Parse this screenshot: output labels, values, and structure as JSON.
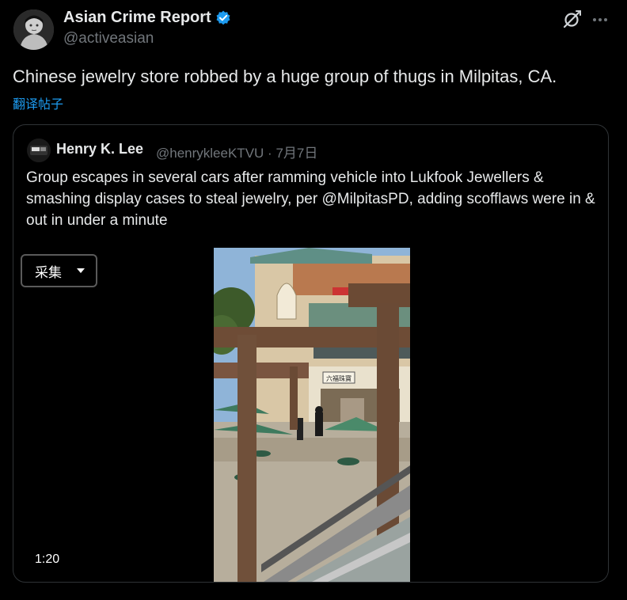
{
  "post": {
    "author_name": "Asian Crime Report",
    "author_handle": "@activeasian",
    "text": "Chinese jewelry store robbed by a huge group of thugs in Milpitas, CA.",
    "translate_label": "翻译帖子",
    "grok_icon": "grok-icon",
    "more_icon": "more-icon",
    "verified_color": "#1d9bf0"
  },
  "quote": {
    "author_name": "Henry K. Lee",
    "author_handle": "@henrykleeKTVU",
    "separator": "·",
    "date": "7月7日",
    "text": "Group escapes in several cars after ramming vehicle into Lukfook Jewellers & smashing display cases to steal jewelry, per @MilpitasPD, adding scofflaws were in & out in under a minute",
    "collect_label": "采集",
    "video_duration": "1:20",
    "store_sign": "六福珠寶"
  },
  "colors": {
    "background": "#000000",
    "text": "#e7e9ea",
    "muted": "#71767b",
    "accent": "#1d9bf0",
    "border": "#2f3336"
  }
}
